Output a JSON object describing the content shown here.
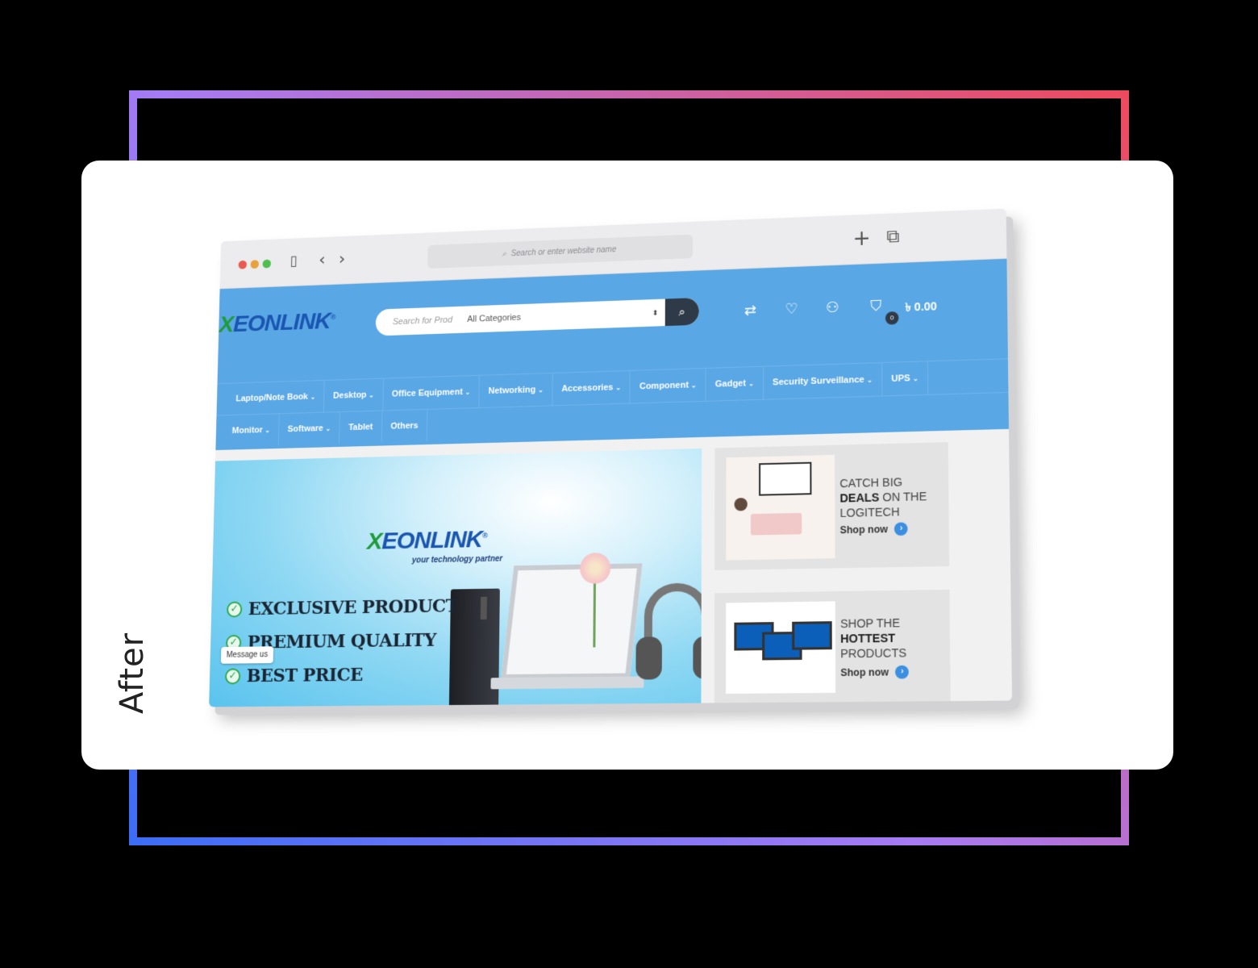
{
  "label": "After",
  "browser": {
    "url_placeholder": "Search or enter website name",
    "search_glyph": "⌕",
    "sidebar_glyph": "▯",
    "back_glyph": "‹",
    "forward_glyph": "›",
    "new_tab_glyph": "+",
    "tabs_glyph": "⧉"
  },
  "site": {
    "logo_x": "X",
    "logo_rest": "EONLINK",
    "logo_reg": "®",
    "search": {
      "placeholder": "Search for Prod",
      "category": "All Categories",
      "select_glyph": "⬍",
      "button_glyph": "⌕"
    },
    "header_icons": {
      "compare": "⇄",
      "wishlist": "♡",
      "account": "⚇",
      "cart": "⛉"
    },
    "cart_count": "0",
    "cart_total": "৳ 0.00",
    "nav_row1": [
      "Laptop/Note Book",
      "Desktop",
      "Office Equipment",
      "Networking",
      "Accessories",
      "Component",
      "Gadget",
      "Security Surveillance",
      "UPS"
    ],
    "nav_row2": [
      "Monitor",
      "Software",
      "Tablet",
      "Others"
    ],
    "nav_row2_chevrons": [
      true,
      true,
      false,
      false
    ],
    "chevron": "⌄"
  },
  "hero": {
    "logo_x": "X",
    "logo_rest": "EONLINK",
    "logo_reg": "®",
    "tagline": "your technology partner",
    "features": [
      "EXCLUSIVE PRODUCT",
      "PREMIUM QUALITY",
      "BEST PRICE"
    ],
    "check_glyph": "✓",
    "message_button": "Message us"
  },
  "promo1": {
    "line1": "CATCH BIG",
    "line2_bold": "DEALS",
    "line2_rest": " ON THE",
    "line3": "LOGITECH",
    "cta": "Shop now",
    "cta_glyph": "›"
  },
  "promo2": {
    "line1": "SHOP THE",
    "line2_bold": "HOTTEST",
    "line3": "PRODUCTS",
    "cta": "Shop now",
    "cta_glyph": "›"
  },
  "colors": {
    "header_blue": "#5aa7e6",
    "logo_green": "#1f9b3b",
    "logo_blue": "#1a56b0",
    "search_button": "#2e3a47"
  }
}
